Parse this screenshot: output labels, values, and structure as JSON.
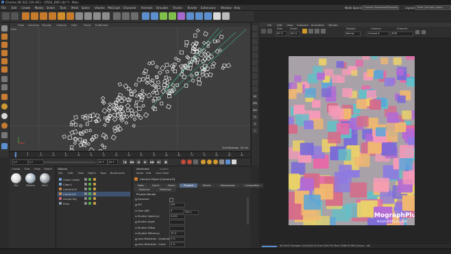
{
  "window": {
    "title": "Cinema 4D S22.116 (RC) - [0502_DOF.c4d *] - Main"
  },
  "menubar": {
    "items": [
      "File",
      "Edit",
      "Create",
      "Modes",
      "Select",
      "Tools",
      "Mesh",
      "Spline",
      "Volume",
      "MoGraph",
      "Character",
      "Animate",
      "Simulate",
      "Tracker",
      "Render",
      "Extensions",
      "Window",
      "Help"
    ],
    "node_space_label": "Node Space:",
    "node_space_value": "Current (Standard/Physical)",
    "layout_label": "Layout:",
    "layout_value": "Start (All Lab) (User)"
  },
  "viewport": {
    "menu": [
      "View",
      "Cameras",
      "Display",
      "Options",
      "Filter",
      "Panel",
      "ProRender"
    ],
    "camera_label": "Free",
    "grid_spacing": "Grid Spacing : 10 cm"
  },
  "timeline": {
    "ticks": [
      "0",
      "5",
      "10",
      "15",
      "20",
      "25",
      "30",
      "35",
      "40",
      "45",
      "50",
      "55",
      "60",
      "65",
      "70",
      "75",
      "80",
      "85",
      "90"
    ],
    "end_label": "90 F"
  },
  "transport": {
    "start_frame": "0 F",
    "current_frame": "0 F",
    "end_frame": "90 F",
    "max_frame": "90 F",
    "buttons": [
      "|◀",
      "◀◀",
      "◀",
      "▶",
      "▶▶",
      "▶|",
      "●"
    ]
  },
  "mid_strip": [
    "",
    "",
    "",
    "",
    "",
    "",
    "",
    "",
    "",
    "",
    "OP",
    "3PK",
    "Ass",
    "Tx",
    "A",
    "L"
  ],
  "picture_viewer": {
    "menu": [
      "File",
      "Edit",
      "View",
      "Compare",
      "Animation",
      "Render"
    ],
    "size_label": "Size:",
    "size_value": "62 %",
    "zoom_label": "Zoom:",
    "zoom_value": "100 %",
    "display_label": "Display:",
    "display_value": "Beauty",
    "camera_label": "Camera:",
    "camera_value": "Camera 8",
    "channel_label": "Channel:",
    "channel_value": "RGB",
    "status": "00:00:02  Samples 12/4/3/3(2/3)  Size 540x720  Mem 2048.99 MB  (Output - v8)",
    "watermark_title": "MographPlus",
    "watermark_sub": "MOGRAPHPLUS.COM"
  },
  "materials": {
    "menu": [
      "Create",
      "Edit",
      "View",
      "Select",
      "Material",
      "Texture"
    ],
    "items": [
      {
        "label": "Mat",
        "color": "#d9d9d9"
      },
      {
        "label": "Material",
        "color": "#a7b4c2"
      },
      {
        "label": "Mat.1",
        "color": "#9aa0a8"
      }
    ]
  },
  "objects": {
    "tabs": [
      "Objects",
      "Takes"
    ],
    "menu": [
      "File",
      "Edit",
      "View",
      "Object",
      "Tags",
      "Bookmarks"
    ],
    "rows": [
      {
        "name": "Cover Cubes",
        "icon_color": "#7aa5d6",
        "highlight": false
      },
      {
        "name": "Cube.1",
        "icon_color": "#7aa5d6",
        "highlight": false
      },
      {
        "name": "Camera.01",
        "icon_color": "#c98b4a",
        "highlight": false
      },
      {
        "name": "Camera.8",
        "icon_color": "#c98b4a",
        "highlight": true
      },
      {
        "name": "Arnold Sky",
        "icon_color": "#c96a7a",
        "highlight": false
      },
      {
        "name": "Floor",
        "icon_color": "#8aa0b6",
        "highlight": false
      }
    ]
  },
  "attributes": {
    "tabs": [
      "Attributes",
      "Layers"
    ],
    "menu": [
      "Mode",
      "Edit",
      "User Data"
    ],
    "object_title": "Camera Object [Camera.8]",
    "tabs_row1": [
      "Basic",
      "Coord.",
      "Object",
      "Physical",
      "Details",
      "Stereoscopic",
      "Composition"
    ],
    "tabs_row2": [
      "Spherical",
      "Protection"
    ],
    "section": "Physical Render",
    "rows": [
      {
        "key": "Exposure",
        "value": ""
      },
      {
        "key": "ISO",
        "value": "200"
      },
      {
        "key": "Gain (dB)",
        "value": "0"
      },
      {
        "key": "Shutter Speed (s)",
        "value": "0.033"
      },
      {
        "key": "Shutter Angle",
        "value": ""
      },
      {
        "key": "Shutter Offset",
        "value": ""
      },
      {
        "key": "Shutter Efficiency",
        "value": "70 %"
      },
      {
        "key": "Lens Distortion - Quadratic",
        "value": "0 %"
      },
      {
        "key": "Lens Distortion - Cubic",
        "value": "0 %"
      }
    ],
    "shutter_preset": "1/30 s"
  },
  "colors": {
    "accent": "#e8a33a",
    "viewport_bg": "#3e3e3e",
    "camera_lines": "#3fa57a"
  }
}
